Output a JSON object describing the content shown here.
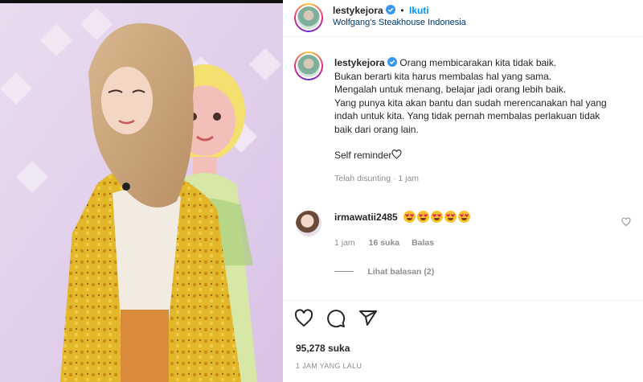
{
  "post": {
    "username": "lestykejora",
    "separator": "•",
    "follow_label": "Ikuti",
    "location": "Wolfgang's Steakhouse Indonesia"
  },
  "caption": {
    "username": "lestykejora",
    "lines": [
      "Orang membicarakan kita tidak baik.",
      "Bukan berarti kita harus membalas hal yang sama.",
      "Mengalah untuk menang, belajar jadi orang lebih baik.",
      "Yang punya kita akan bantu dan sudah merencanakan hal yang",
      "indah untuk kita. Yang tidak pernah membalas perlakuan tidak",
      "baik dari orang lain."
    ],
    "reminder": "Self reminder",
    "edited_meta": "Telah disunting · 1 jam"
  },
  "comment": {
    "username": "irmawatii2485",
    "emoji_count": 5,
    "time": "1 jam",
    "likes": "16 suka",
    "reply_label": "Balas",
    "view_replies": "Lihat balasan (2)"
  },
  "actions": {
    "icons": [
      "heart-icon",
      "comment-icon",
      "share-icon"
    ],
    "likes": "95,278 suka",
    "timestamp": "1 JAM YANG LALU"
  },
  "colors": {
    "accent": "#0095f6",
    "verified": "#3897f0",
    "muted": "#8e8e8e",
    "text": "#262626"
  }
}
